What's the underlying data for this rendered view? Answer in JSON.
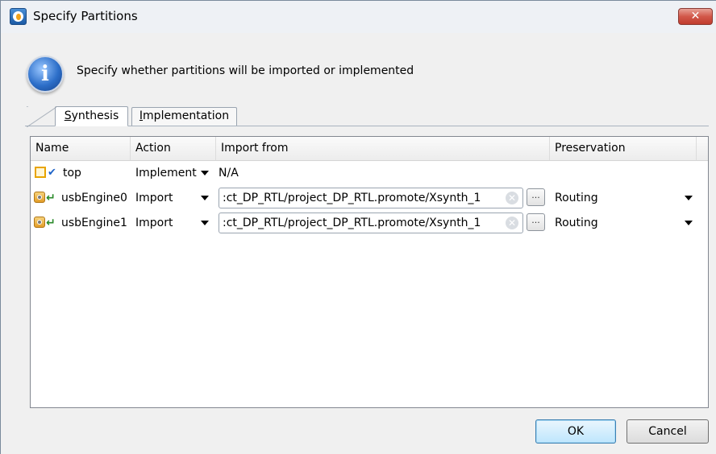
{
  "window": {
    "title": "Specify Partitions",
    "close_label": "✕"
  },
  "info": {
    "message": "Specify whether partitions will be imported or implemented",
    "icon_glyph": "i"
  },
  "tabs": [
    {
      "label": "Synthesis",
      "underline": "S",
      "rest": "ynthesis",
      "active": true
    },
    {
      "label": "Implementation",
      "underline": "I",
      "rest": "mplementation",
      "active": false
    }
  ],
  "table": {
    "columns": [
      "Name",
      "Action",
      "Import from",
      "Preservation"
    ],
    "rows": [
      {
        "name": "top",
        "action": "Implement",
        "import_from": "N/A",
        "preservation": ""
      },
      {
        "name": "usbEngine0",
        "action": "Import",
        "import_from": ":ct_DP_RTL/project_DP_RTL.promote/Xsynth_1",
        "preservation": "Routing"
      },
      {
        "name": "usbEngine1",
        "action": "Import",
        "import_from": ":ct_DP_RTL/project_DP_RTL.promote/Xsynth_1",
        "preservation": "Routing"
      }
    ]
  },
  "buttons": {
    "ok": "OK",
    "cancel": "Cancel",
    "browse": "..."
  },
  "colors": {
    "accent": "#3c7fb1",
    "close": "#c03b2d"
  }
}
